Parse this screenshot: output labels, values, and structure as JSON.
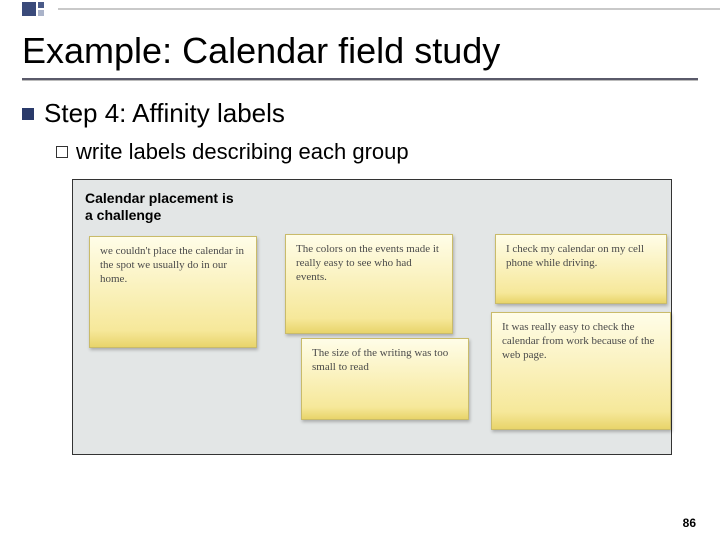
{
  "slide": {
    "title": "Example: Calendar field study",
    "bullet": "Step 4: Affinity labels",
    "subbullet_prefix": "write",
    "subbullet_rest": " labels describing each group",
    "group_label": "Calendar placement is a challenge",
    "page_number": "86"
  },
  "notes": {
    "n1": "we couldn't place the calendar in the spot we usually do in our home.",
    "n2": "The colors on the events made it really easy to see who had events.",
    "n3": "The size of the writing was too small to read",
    "n4": "I check my calendar on my cell phone while driving.",
    "n5": "It was really easy to check the calendar from work because of the web page."
  }
}
